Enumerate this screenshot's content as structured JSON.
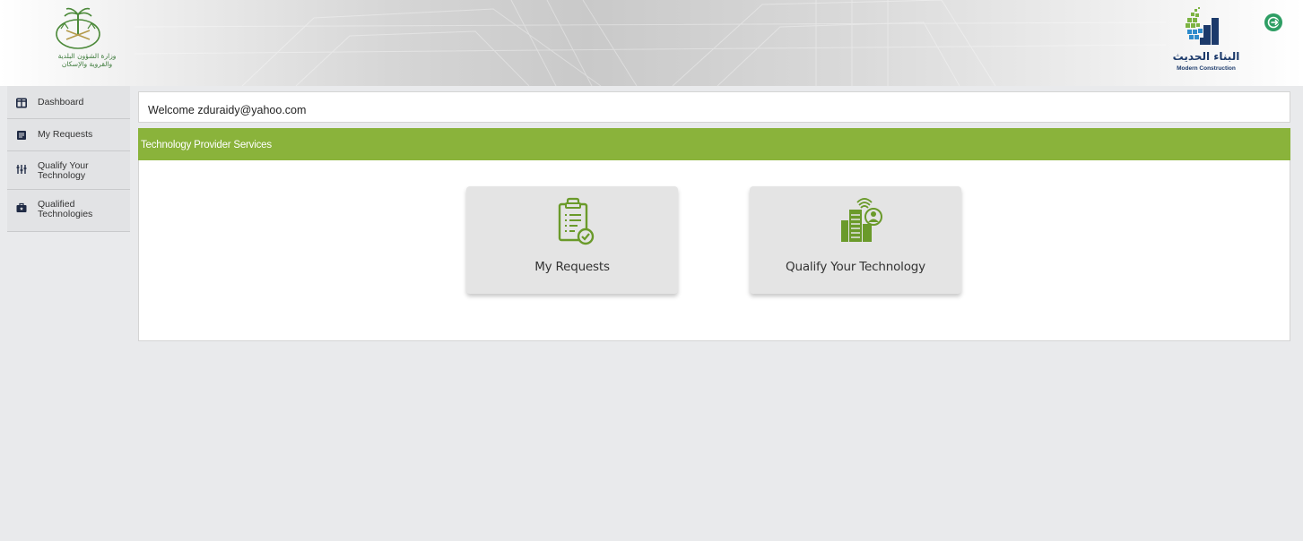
{
  "header": {
    "ministry_logo": {
      "arabic_line1": "وزارة الشؤون البلدية",
      "arabic_line2": "والقروية والإسكان",
      "icon": "saudi-emblem-icon"
    },
    "partner_logo": {
      "arabic": "البناء الحديث",
      "english": "Modern Construction",
      "icon": "modern-construction-mark-icon"
    },
    "logout_icon": "logout-icon"
  },
  "sidebar": {
    "items": [
      {
        "label": "Dashboard",
        "icon": "dashboard-icon"
      },
      {
        "label": "My Requests",
        "icon": "requests-icon"
      },
      {
        "label": "Qualify Your Technology",
        "icon": "qualify-icon"
      },
      {
        "label": "Qualified Technologies",
        "icon": "briefcase-icon"
      }
    ]
  },
  "main": {
    "welcome_text": "Welcome zduraidy@yahoo.com",
    "panel_title": "Technology Provider Services",
    "cards": [
      {
        "label": "My Requests",
        "icon": "clipboard-check-icon"
      },
      {
        "label": "Qualify Your Technology",
        "icon": "buildings-user-icon"
      }
    ]
  },
  "colors": {
    "accent_green": "#8ab33b",
    "icon_green": "#6a9a2a",
    "logout_green": "#2e9e64",
    "brand_navy": "#1c3a6b"
  }
}
